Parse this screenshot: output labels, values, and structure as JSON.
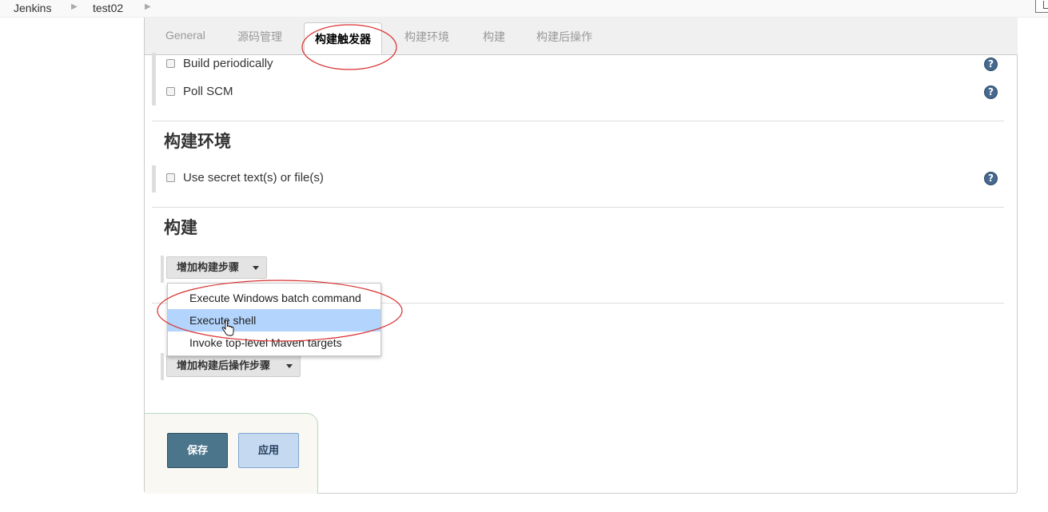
{
  "breadcrumb": {
    "items": [
      "Jenkins",
      "test02"
    ]
  },
  "tabs": [
    {
      "label": "General"
    },
    {
      "label": "源码管理"
    },
    {
      "label": "构建触发器"
    },
    {
      "label": "构建环境"
    },
    {
      "label": "构建"
    },
    {
      "label": "构建后操作"
    }
  ],
  "active_tab": "构建触发器",
  "triggers": {
    "items": [
      {
        "label": "Build periodically",
        "checked": false
      },
      {
        "label": "Poll SCM",
        "checked": false
      }
    ]
  },
  "build_env": {
    "title": "构建环境",
    "items": [
      {
        "label": "Use secret text(s) or file(s)",
        "checked": false
      }
    ]
  },
  "build": {
    "title": "构建",
    "add_step_label": "增加构建步骤"
  },
  "build_step_menu": {
    "items": [
      {
        "label": "Execute Windows batch command"
      },
      {
        "label": "Execute shell"
      },
      {
        "label": "Invoke top-level Maven targets"
      }
    ],
    "highlighted": "Execute shell"
  },
  "post_build": {
    "add_step_label": "增加构建后操作步骤"
  },
  "actions": {
    "save_label": "保存",
    "apply_label": "应用"
  },
  "help_icon_glyph": "?",
  "colors": {
    "save_button": "#4b758b",
    "apply_button": "#c5d9f1",
    "menu_highlight": "#b3d4fc",
    "annotation_circle": "#d93030"
  }
}
